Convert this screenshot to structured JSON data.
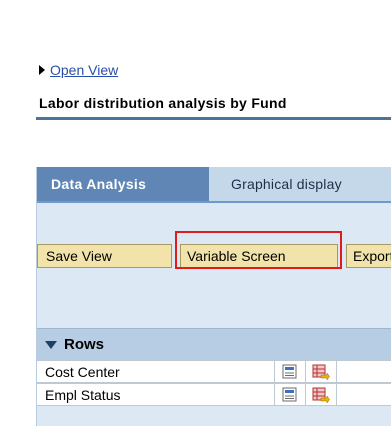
{
  "header": {
    "open_view_label": "Open View",
    "report_title": "Labor distribution analysis by Fund"
  },
  "tabs": [
    {
      "label": "Data Analysis",
      "active": true
    },
    {
      "label": "Graphical display",
      "active": false
    }
  ],
  "toolbar": {
    "save_view_label": "Save View",
    "variable_screen_label": "Variable Screen",
    "export_label": "Export"
  },
  "rows_section": {
    "title": "Rows",
    "items": [
      {
        "label": "Cost Center"
      },
      {
        "label": "Empl Status"
      }
    ]
  },
  "colors": {
    "accent_tab": "#5f86b4",
    "button_bg": "#f2e3ab",
    "highlight": "#e01b1b",
    "link": "#2a4fa8"
  },
  "icons": [
    "triangle-right-icon",
    "triangle-down-icon",
    "filter-icon",
    "swap-axis-icon"
  ]
}
